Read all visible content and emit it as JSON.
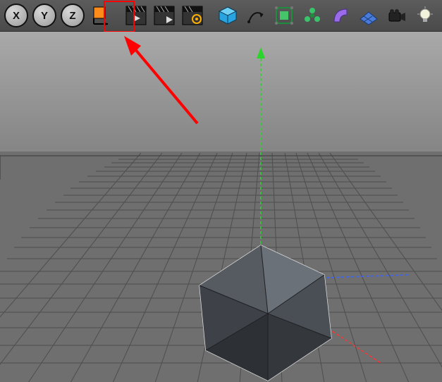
{
  "toolbar": {
    "axis_x": "X",
    "axis_y": "Y",
    "axis_z": "Z"
  },
  "annotation": {
    "highlighted_tool": "render-view"
  }
}
